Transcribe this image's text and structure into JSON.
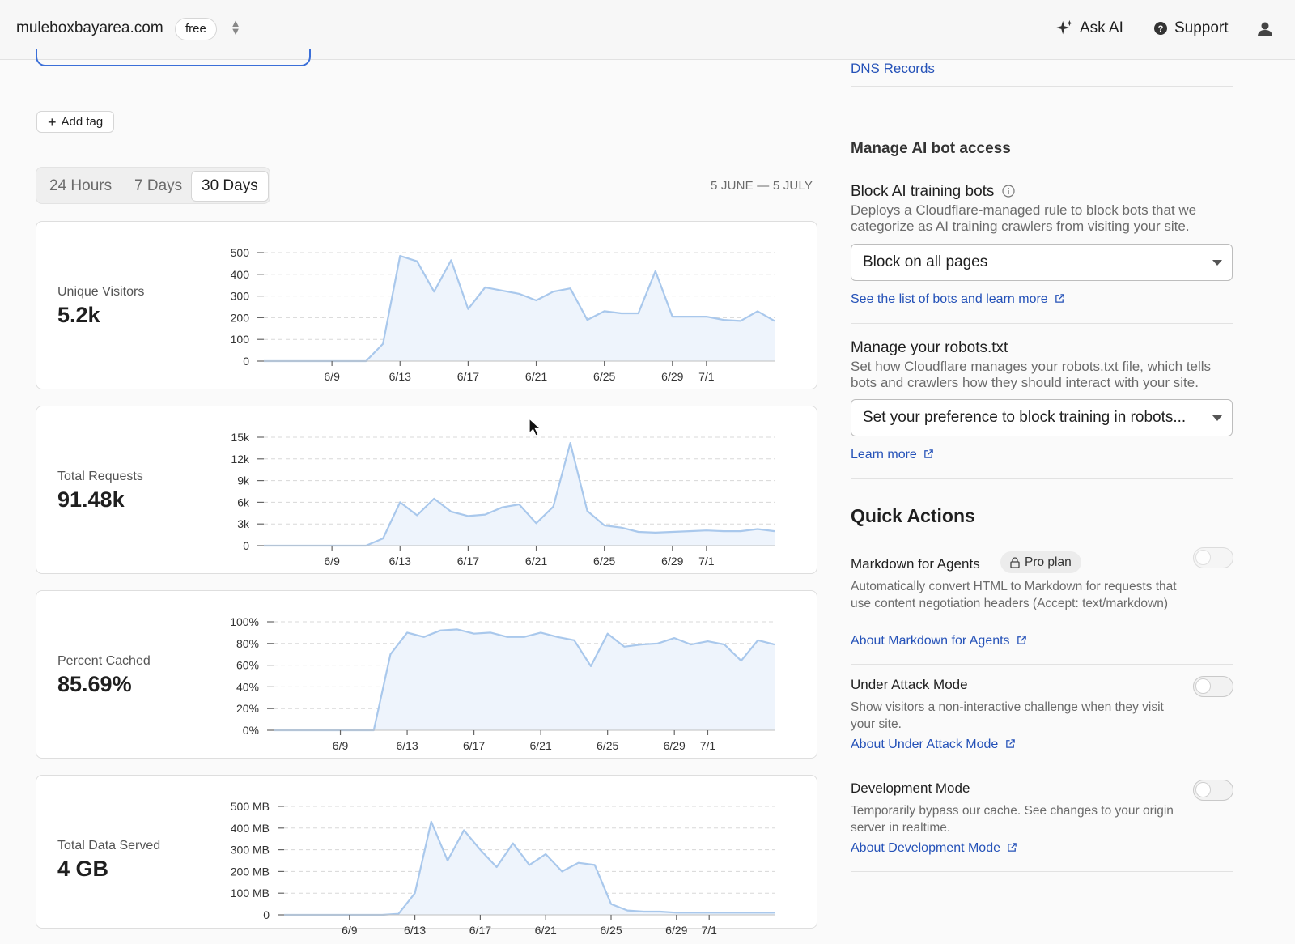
{
  "topbar": {
    "domain": "muleboxbayarea.com",
    "plan": "free",
    "ask_ai": "Ask AI",
    "support": "Support"
  },
  "overview": {
    "add_tag": "Add tag",
    "time_ranges": [
      "24 Hours",
      "7 Days",
      "30 Days"
    ],
    "selected_range": "30 Days",
    "date_range": "5 JUNE — 5 JULY"
  },
  "metrics": [
    {
      "label": "Unique Visitors",
      "value": "5.2k"
    },
    {
      "label": "Total Requests",
      "value": "91.48k"
    },
    {
      "label": "Percent Cached",
      "value": "85.69%"
    },
    {
      "label": "Total Data Served",
      "value": "4 GB"
    }
  ],
  "chart_data": [
    {
      "type": "area",
      "title": "Unique Visitors",
      "x_ticks": [
        "6/9",
        "6/13",
        "6/17",
        "6/21",
        "6/25",
        "6/29",
        "7/1"
      ],
      "y_ticks": [
        "0",
        "100",
        "200",
        "300",
        "400",
        "500"
      ],
      "ylim": [
        0,
        500
      ],
      "values": [
        0,
        0,
        0,
        0,
        0,
        0,
        0,
        80,
        485,
        460,
        320,
        465,
        240,
        340,
        325,
        310,
        280,
        320,
        335,
        190,
        230,
        220,
        220,
        415,
        205,
        205,
        205,
        190,
        185,
        230,
        185
      ]
    },
    {
      "type": "area",
      "title": "Total Requests",
      "x_ticks": [
        "6/9",
        "6/13",
        "6/17",
        "6/21",
        "6/25",
        "6/29",
        "7/1"
      ],
      "y_ticks": [
        "0",
        "3k",
        "6k",
        "9k",
        "12k",
        "15k"
      ],
      "ylim": [
        0,
        15000
      ],
      "values": [
        0,
        0,
        0,
        0,
        0,
        0,
        0,
        1000,
        6000,
        4200,
        6500,
        4700,
        4100,
        4300,
        5300,
        5700,
        3100,
        5400,
        14200,
        4800,
        2800,
        2500,
        1900,
        1800,
        1900,
        2000,
        2100,
        2000,
        2000,
        2300,
        2000
      ]
    },
    {
      "type": "area",
      "title": "Percent Cached",
      "x_ticks": [
        "6/9",
        "6/13",
        "6/17",
        "6/21",
        "6/25",
        "6/29",
        "7/1"
      ],
      "y_ticks": [
        "0%",
        "20%",
        "40%",
        "60%",
        "80%",
        "100%"
      ],
      "ylim": [
        0,
        100
      ],
      "values": [
        0,
        0,
        0,
        0,
        0,
        0,
        0,
        70,
        90,
        86,
        92,
        93,
        89,
        90,
        86,
        86,
        90,
        86,
        83,
        59,
        89,
        77,
        79,
        80,
        85,
        79,
        82,
        79,
        64,
        83,
        79
      ]
    },
    {
      "type": "area",
      "title": "Total Data Served",
      "x_ticks": [
        "6/9",
        "6/13",
        "6/17",
        "6/21",
        "6/25",
        "6/29",
        "7/1"
      ],
      "y_ticks": [
        "0",
        "100 MB",
        "200 MB",
        "300 MB",
        "400 MB",
        "500 MB"
      ],
      "ylim": [
        0,
        500
      ],
      "values": [
        0,
        0,
        0,
        0,
        0,
        0,
        0,
        5,
        100,
        430,
        250,
        390,
        300,
        220,
        330,
        230,
        280,
        200,
        240,
        230,
        50,
        20,
        15,
        15,
        10,
        10,
        10,
        10,
        10,
        10,
        10
      ]
    }
  ],
  "sidebar": {
    "dns_records": "DNS Records",
    "ai_section_title": "Manage AI bot access",
    "block_training": {
      "title": "Block AI training bots",
      "description": "Deploys a Cloudflare-managed rule to block bots that we categorize as AI training crawlers from visiting your site.",
      "selected": "Block on all pages",
      "link": "See the list of bots and learn more"
    },
    "robots": {
      "title": "Manage your robots.txt",
      "description": "Set how Cloudflare manages your robots.txt file, which tells bots and crawlers how they should interact with your site.",
      "selected": "Set your preference to block training in robots...",
      "link": "Learn more"
    },
    "quick_actions": {
      "title": "Quick Actions",
      "items": [
        {
          "name": "Markdown for Agents",
          "badge": "Pro plan",
          "description": "Automatically convert HTML to Markdown for requests that use content negotiation headers (Accept: text/markdown)",
          "link": "About Markdown for Agents",
          "enabled": false
        },
        {
          "name": "Under Attack Mode",
          "description": "Show visitors a non-interactive challenge when they visit your site.",
          "link": "About Under Attack Mode",
          "enabled": false
        },
        {
          "name": "Development Mode",
          "description": "Temporarily bypass our cache. See changes to your origin server in realtime.",
          "link": "About Development Mode",
          "enabled": false
        }
      ]
    }
  },
  "colors": {
    "accent_link": "#2552b8",
    "chart_line": "#a9c8ec",
    "chart_fill": "#eef4fc"
  }
}
